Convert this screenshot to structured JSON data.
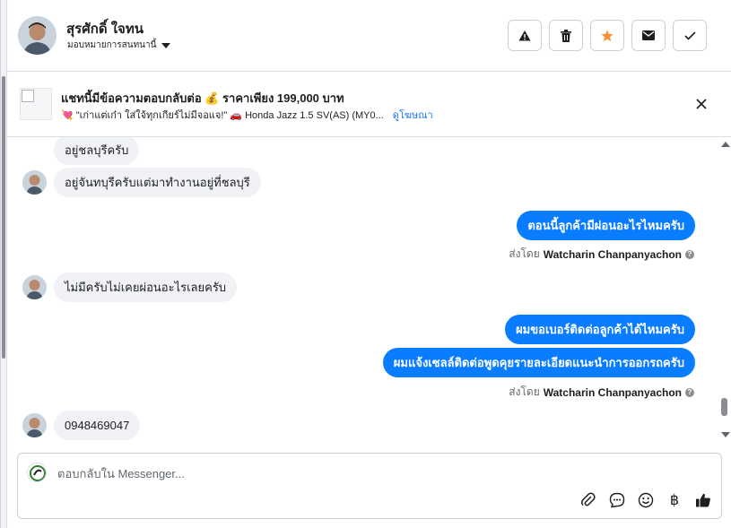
{
  "header": {
    "contact_name": "สุรศักดิ์ ใจทน",
    "assign_label": "มอบหมายการสนทนานี้",
    "actions": [
      {
        "name": "report-spam-button",
        "icon": "warning-icon"
      },
      {
        "name": "delete-button",
        "icon": "trash-icon"
      },
      {
        "name": "star-button",
        "icon": "star-icon"
      },
      {
        "name": "mark-unread-button",
        "icon": "envelope-icon"
      },
      {
        "name": "mark-done-button",
        "icon": "check-icon"
      }
    ]
  },
  "ad": {
    "title": "แชทนี้มีข้อความตอบกลับต่อ 💰 ราคาเพียง 199,000 บาท",
    "subtitle": "💘 \"เก่าแต่เก๋า ใส่ใจ้ทุกเกียร์ไม่มีจอแจ!\" 🚗 Honda Jazz 1.5 SV(AS) (MY0...",
    "view_ad_label": "ดูโฆษณา"
  },
  "messages": [
    {
      "direction": "in",
      "text": "อยู่ชลบุรีครับ",
      "avatar": false
    },
    {
      "direction": "in",
      "text": "อยู่จันทบุรีครับแต่มาทำงานอยู่ที่ชลบุรี",
      "avatar": true
    },
    {
      "direction": "out",
      "text": "ตอนนี้ลูกค้ามีผ่อนอะไรไหมครับ"
    },
    {
      "direction": "in",
      "text": "ไม่มีครับไม่เคยผ่อนอะไรเลยครับ",
      "avatar": true
    },
    {
      "direction": "out",
      "text": "ผมขอเบอร์ติดต่อลูกค้าได้ไหมครับ"
    },
    {
      "direction": "out",
      "text": "ผมแจ้งเซลล์ติดต่อพูดคุยรายละเอียดแนะนำการออกรถครับ"
    },
    {
      "direction": "in",
      "text": "0948469047",
      "avatar": true
    }
  ],
  "sent_by": {
    "prefix": "ส่งโดย",
    "agent": "Watcharin Chanpanyachon",
    "info": "?"
  },
  "composer": {
    "placeholder": "ตอบกลับใน Messenger...",
    "tools": [
      "paperclip-icon",
      "saved-reply-icon",
      "emoji-icon",
      "baht-icon",
      "thumbs-up-icon"
    ],
    "baht_symbol": "฿"
  },
  "colors": {
    "outgoing_bubble": "#0a7cff",
    "incoming_bubble": "#f0f2f5",
    "star": "#f7923b",
    "link": "#1877f2"
  }
}
